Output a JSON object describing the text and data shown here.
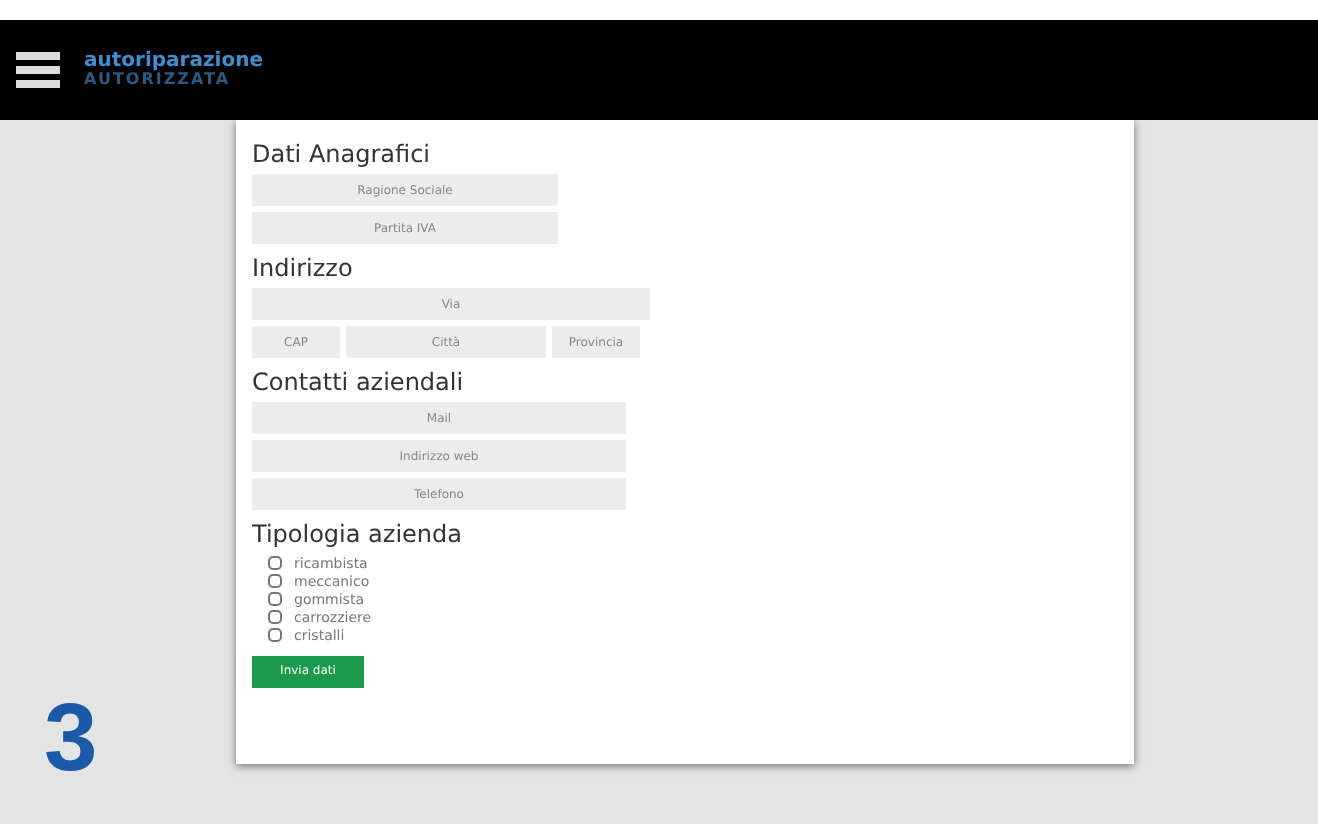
{
  "header": {
    "logo_top": "autoriparazione",
    "logo_bottom": "AUTORIZZATA"
  },
  "form": {
    "sections": [
      {
        "title": "Dati Anagrafici",
        "fields": [
          {
            "placeholder": "Ragione Sociale"
          },
          {
            "placeholder": "Partita IVA"
          }
        ]
      },
      {
        "title": "Indirizzo",
        "street": {
          "placeholder": "Via"
        },
        "fields": [
          {
            "placeholder": "CAP"
          },
          {
            "placeholder": "Città"
          },
          {
            "placeholder": "Provincia"
          }
        ]
      },
      {
        "title": "Contatti aziendali",
        "fields": [
          {
            "placeholder": "Mail"
          },
          {
            "placeholder": "Indirizzo web"
          },
          {
            "placeholder": "Telefono"
          }
        ]
      }
    ],
    "type_title": "Tipologia azienda",
    "types": [
      {
        "label": "ricambista",
        "checked": false
      },
      {
        "label": "meccanico",
        "checked": false
      },
      {
        "label": "gommista",
        "checked": false
      },
      {
        "label": "carrozziere",
        "checked": false
      },
      {
        "label": "cristalli",
        "checked": false
      }
    ],
    "submit": "Invia dati"
  },
  "step_number": "3"
}
